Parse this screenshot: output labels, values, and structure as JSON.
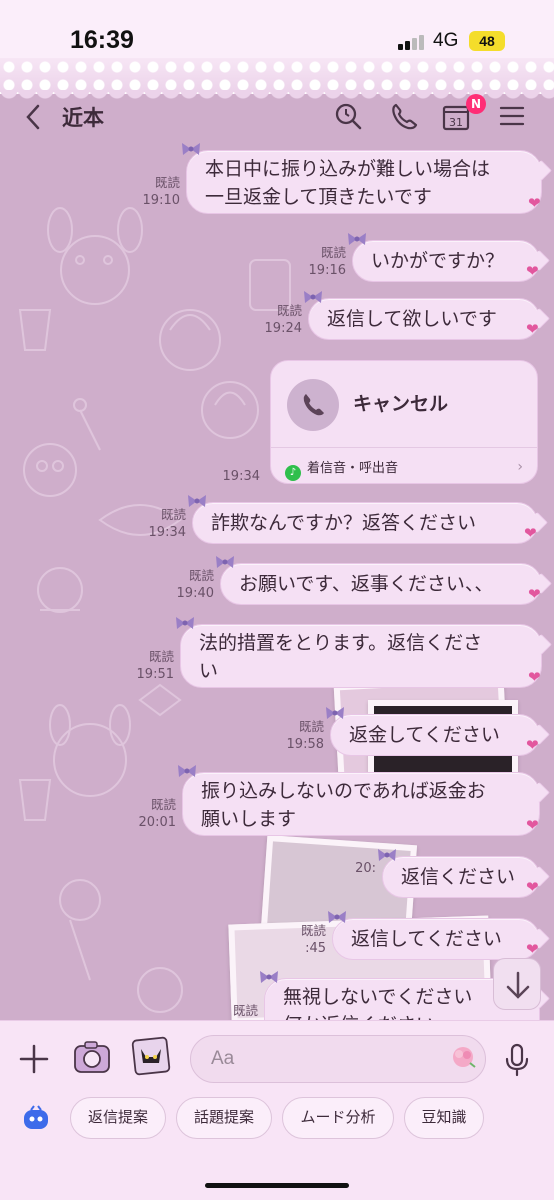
{
  "status_bar": {
    "time": "16:39",
    "network": "4G",
    "battery": "48"
  },
  "header": {
    "title": "近本",
    "calendar_day": "31",
    "calendar_badge": "N"
  },
  "messages": [
    {
      "lines": [
        "本日中に振り込みが難しい場合は",
        "一旦返金して頂きたいです"
      ],
      "read": "既読",
      "time": "19:10"
    },
    {
      "lines": [
        "いかがですか？"
      ],
      "read": "既読",
      "time": "19:16"
    },
    {
      "lines": [
        "返信して欲しいです"
      ],
      "read": "既読",
      "time": "19:24"
    },
    {
      "lines": [
        "詐欺なんですか？返答ください"
      ],
      "read": "既読",
      "time": "19:34"
    },
    {
      "lines": [
        "お願いです、返事ください、、"
      ],
      "read": "既読",
      "time": "19:40"
    },
    {
      "lines": [
        "法的措置をとります。返信くださ",
        "い"
      ],
      "read": "既読",
      "time": "19:51"
    },
    {
      "lines": [
        "返金してください"
      ],
      "read": "既読",
      "time": "19:58"
    },
    {
      "lines": [
        "振り込みしないのであれば返金お",
        "願いします"
      ],
      "read": "既読",
      "time": "20:01"
    },
    {
      "lines": [
        "返信ください"
      ],
      "read": "",
      "time": "20:"
    },
    {
      "lines": [
        "返信してください"
      ],
      "read": "既読",
      "time": ":45"
    },
    {
      "lines": [
        "無視しないでください",
        "何か返信ください"
      ],
      "read": "既読",
      "time": ""
    }
  ],
  "call_card": {
    "label": "キャンセル",
    "time": "19:34",
    "footer": "着信音・呼出音"
  },
  "input": {
    "placeholder": "Aa"
  },
  "suggestions": [
    "返信提案",
    "話題提案",
    "ムード分析",
    "豆知識"
  ],
  "colors": {
    "background": "#cfaecb",
    "bubble": "#f5e0f4",
    "accent_heart": "#e2579e",
    "badge": "#ff2d76",
    "input_bar": "#f8e4f6"
  }
}
